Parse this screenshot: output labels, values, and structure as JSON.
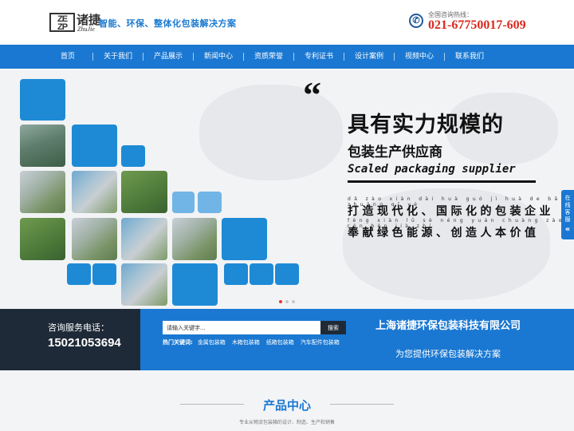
{
  "header": {
    "logo_mark": "ZE\nZP",
    "logo_cn": "诸捷",
    "logo_en": "ZhuJie",
    "slogan": "智能、环保、整体化包装解决方案",
    "hotline_label": "全国咨询热线：",
    "hotline_number": "021-67750017-609",
    "phone_icon": "phone-icon"
  },
  "nav": {
    "items": [
      {
        "label": "首页"
      },
      {
        "label": "关于我们"
      },
      {
        "label": "产品展示"
      },
      {
        "label": "新闻中心"
      },
      {
        "label": "资质荣誉"
      },
      {
        "label": "专利证书"
      },
      {
        "label": "设计案例"
      },
      {
        "label": "视频中心"
      },
      {
        "label": "联系我们"
      }
    ]
  },
  "banner": {
    "quote_mark": "“",
    "headline_1": "具有实力规模的",
    "headline_2": "包装生产供应商",
    "headline_en": "Scaled packaging supplier",
    "pinyin_1": "dǎ zào xiàn dài huà  guó jì huà de bāo zhuāng qǐ yè",
    "line_1": "打造现代化、国际化的包装企业",
    "pinyin_2": "fèng xiàn lǜ sè néng yuán  chuàng zào rén běn jià zhí",
    "line_2": "奉献绿色能源、创造人本价值",
    "slides": 3,
    "active_slide": 1
  },
  "side_service": {
    "label": "在线客服",
    "icon": "double-chevron-left-icon"
  },
  "info_band": {
    "consult_label": "咨询服务电话：",
    "consult_phone": "15021053694",
    "search_placeholder": "请输入关键字...",
    "search_button": "搜索",
    "hot_label": "热门关键词:",
    "hot_keywords": [
      "金属包装箱",
      "木箱包装箱",
      "纸箱包装箱",
      "汽车配件包装箱"
    ],
    "company_name": "上海诸捷环保包装科技有限公司",
    "company_tagline": "为您提供环保包装解决方案"
  },
  "products": {
    "title": "产品中心",
    "subtitle": "专业从物流包装箱的设计、制造、生产和销售"
  },
  "colors": {
    "brand_blue": "#1a78d2",
    "dark_navy": "#1f2a38",
    "hotline_red": "#d82a1e"
  }
}
